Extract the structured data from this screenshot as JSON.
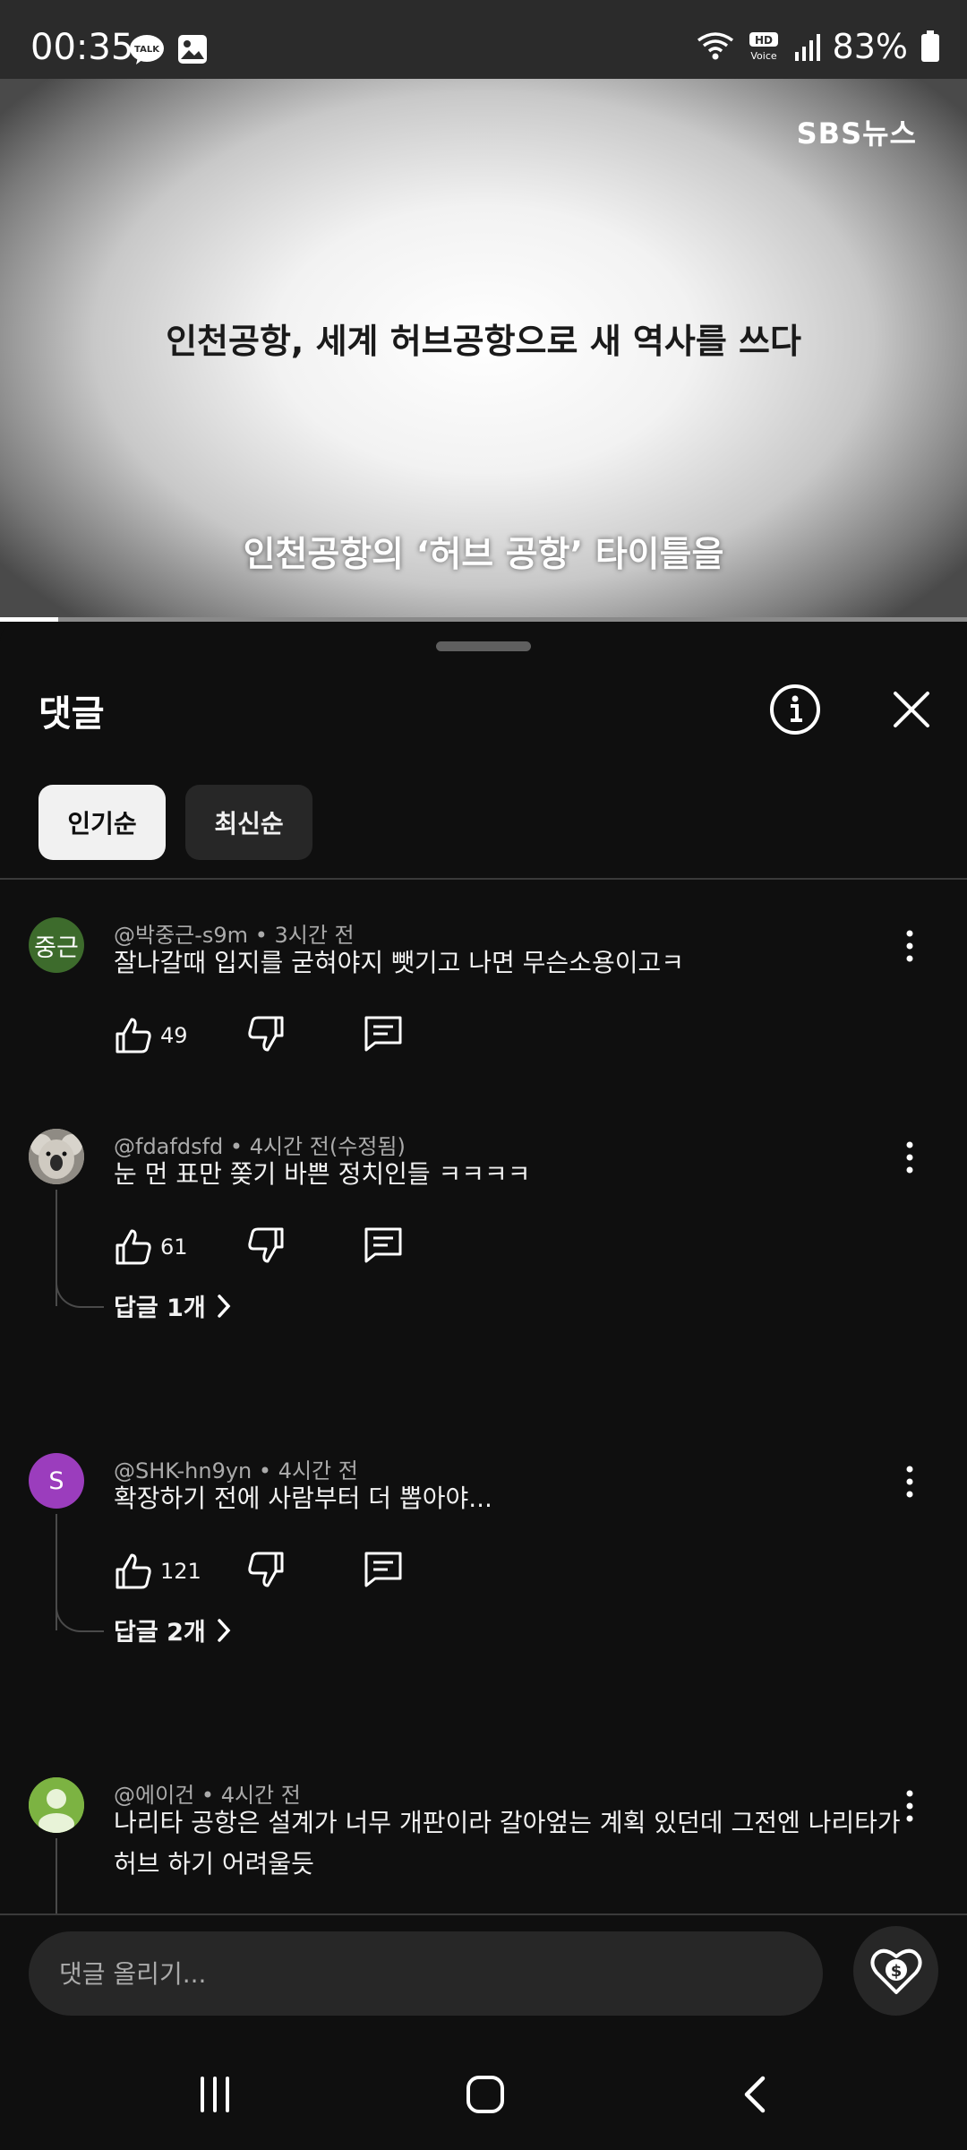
{
  "status_bar": {
    "time": "00:35",
    "battery": "83%",
    "talk_label": "TALK",
    "hd_label": "HD",
    "voice_label": "Voice"
  },
  "video": {
    "channel_logo": "SBS뉴스",
    "headline": "인천공항, 세계 허브공항으로 새 역사를 쓰다",
    "subtitle": "인천공항의 ‘허브 공항’ 타이틀을",
    "progress": 0.06
  },
  "sheet": {
    "title": "댓글",
    "sort_tabs": [
      {
        "label": "인기순",
        "active": true
      },
      {
        "label": "최신순",
        "active": false
      }
    ]
  },
  "comments": [
    {
      "avatar_text": "중근",
      "avatar_color": "#3d6b2c",
      "author": "@박중근-s9m",
      "time": "3시간 전",
      "text": "잘나갈때 입지를 굳혀야지 뺏기고 나면 무슨소용이고ㅋ",
      "likes": "49"
    },
    {
      "avatar_text": "",
      "avatar_color": "#b9b4aa",
      "author": "@fdafdsfd",
      "time": "4시간 전(수정됨)",
      "text": "눈 먼 표만 쫒기 바쁜 정치인들 ㅋㅋㅋㅋ",
      "likes": "61",
      "replies": "답글 1개"
    },
    {
      "avatar_text": "S",
      "avatar_color": "#9b3dbd",
      "author": "@SHK-hn9yn",
      "time": "4시간 전",
      "text": "확장하기 전에 사람부터 더 뽑아야...",
      "likes": "121",
      "replies": "답글 2개"
    },
    {
      "avatar_text": "",
      "avatar_color": "#7cb342",
      "author": "@에이건",
      "time": "4시간 전",
      "text": "나리타 공항은 설계가 너무 개판이라 갈아엎는 계획 있던데 그전엔 나리타가 허브 하기 어려울듯"
    }
  ],
  "input": {
    "placeholder": "댓글 올리기..."
  },
  "colors": {
    "background": "#0f0f0f",
    "chip_active": "#f1f1f1",
    "chip_inactive": "#272727",
    "meta_text": "#aaaaaa"
  }
}
